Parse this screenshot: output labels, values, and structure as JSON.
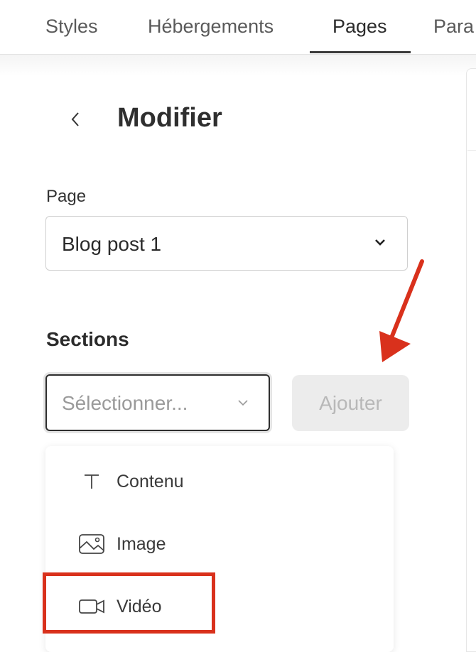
{
  "tabs": [
    {
      "label": "Styles",
      "active": false
    },
    {
      "label": "Hébergements",
      "active": false
    },
    {
      "label": "Pages",
      "active": true
    },
    {
      "label": "Para",
      "active": false
    }
  ],
  "header": {
    "back_icon": "chevron-left-icon",
    "title": "Modifier"
  },
  "page_field": {
    "label": "Page",
    "value": "Blog post 1",
    "icon": "chevron-down-icon"
  },
  "sections": {
    "label": "Sections",
    "select_placeholder": "Sélectionner...",
    "add_button": "Ajouter",
    "add_button_enabled": false
  },
  "menu": {
    "items": [
      {
        "label": "Contenu",
        "icon": "text-icon"
      },
      {
        "label": "Image",
        "icon": "image-icon"
      },
      {
        "label": "Vidéo",
        "icon": "video-icon",
        "highlighted": true
      }
    ]
  },
  "annotation_color": "#d9311c"
}
